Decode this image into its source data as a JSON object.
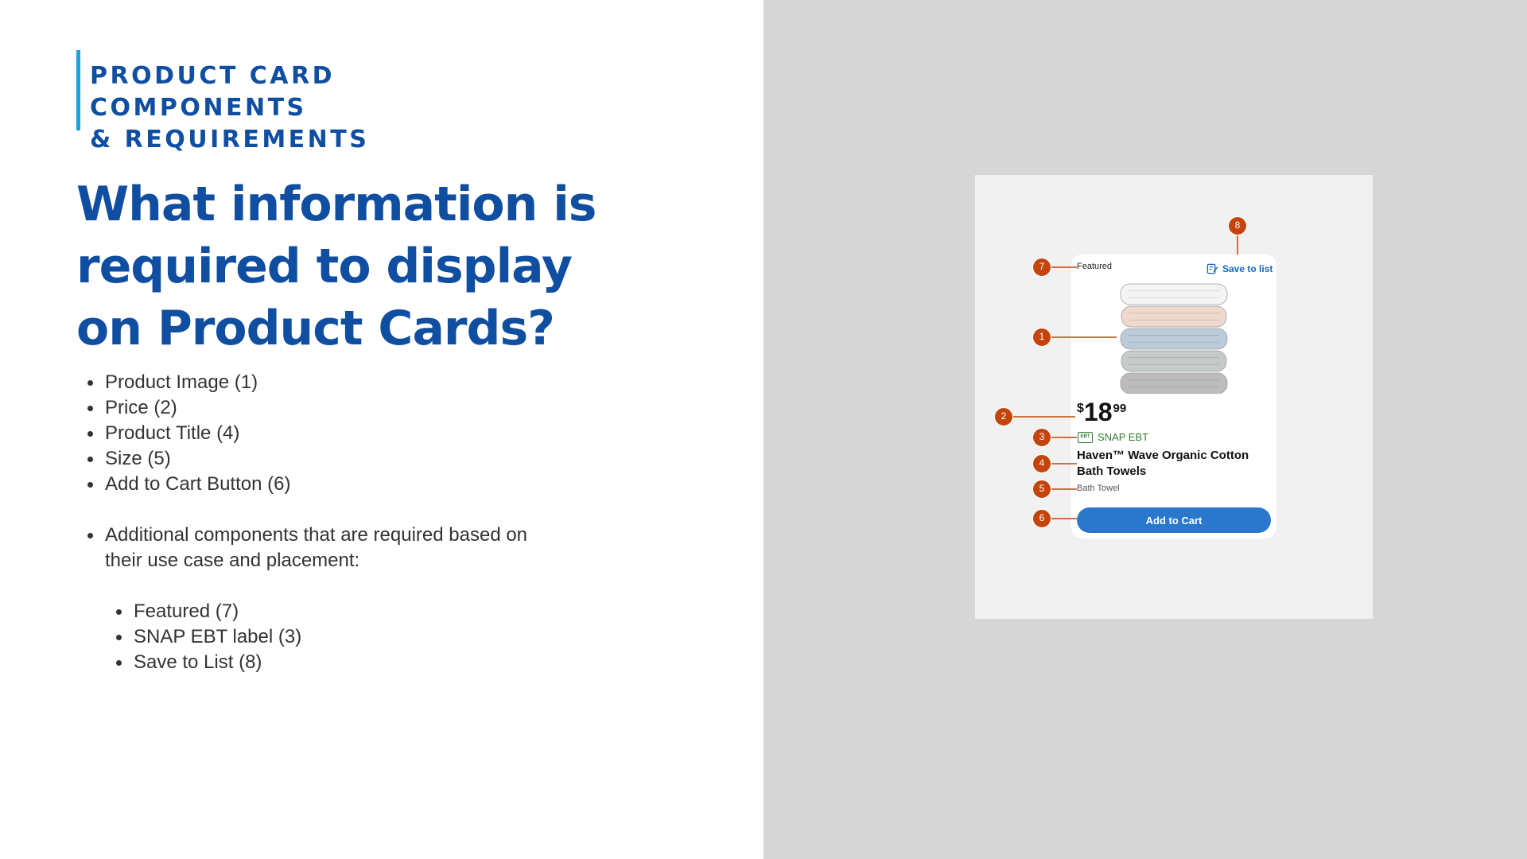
{
  "slide": {
    "eyebrow_line1": "PRODUCT CARD COMPONENTS",
    "eyebrow_line2": "& REQUIREMENTS",
    "heading": "What information is required to display on Product Cards?",
    "required_items": [
      "Product Image (1)",
      "Price (2)",
      "Product Title (4)",
      "Size (5)",
      "Add to Cart Button (6)"
    ],
    "additional_intro": "Additional components that are required based on their use case and placement:",
    "additional_items": [
      "Featured (7)",
      "SNAP EBT label (3)",
      "Save to List (8)"
    ]
  },
  "card": {
    "featured_label": "Featured",
    "save_label": "Save to list",
    "price_currency": "$",
    "price_dollars": "18",
    "price_cents": "99",
    "ebt_badge": "EBT",
    "snap_label": "SNAP EBT",
    "title": "Haven™ Wave Organic Cotton Bath Towels",
    "size": "Bath Towel",
    "add_to_cart": "Add to Cart",
    "icons": [
      "edit-list-icon",
      "ebt-card-icon"
    ],
    "towel_colors": [
      "#f4f4f4",
      "#efd9cf",
      "#bccbd9",
      "#c5cbc8",
      "#bdbdbd"
    ]
  },
  "callouts": [
    "1",
    "2",
    "3",
    "4",
    "5",
    "6",
    "7",
    "8"
  ],
  "colors": {
    "heading_blue": "#0f4ea1",
    "accent_bar": "#1fa2dc",
    "callout_orange": "#c4450c",
    "button_blue": "#2a78cc",
    "snap_green": "#2e7d32"
  }
}
